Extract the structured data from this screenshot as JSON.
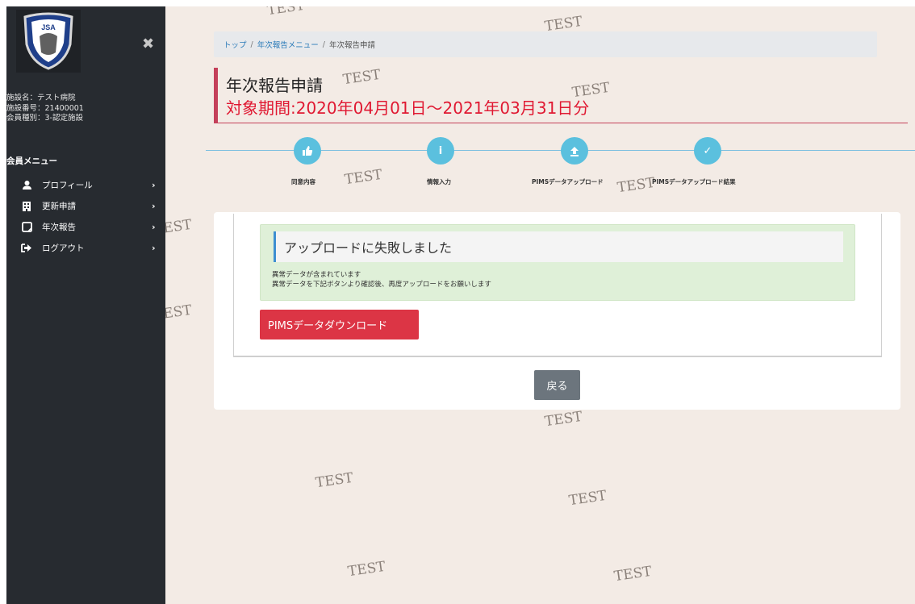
{
  "sidebar": {
    "logo_text": "JSA",
    "close_icon": "close-icon",
    "facility": {
      "name": "施設名：テスト病院",
      "number": "施設番号：21400001",
      "type": "会員種別：3-認定施設"
    },
    "menu_title": "会員メニュー",
    "items": [
      {
        "label": "プロフィール",
        "icon": "user-icon",
        "arrow": "›"
      },
      {
        "label": "更新申請",
        "icon": "building-icon",
        "arrow": "›"
      },
      {
        "label": "年次報告",
        "icon": "edit-icon",
        "arrow": "›"
      },
      {
        "label": "ログアウト",
        "icon": "logout-icon",
        "arrow": "›"
      }
    ]
  },
  "breadcrumb": {
    "top": "トップ",
    "sep": "/",
    "menu": "年次報告メニュー",
    "current": "年次報告申請"
  },
  "page": {
    "title": "年次報告申請",
    "period": "対象期間:2020年04月01日～2021年03月31日分"
  },
  "steps": [
    {
      "label": "同意内容",
      "icon": "thumbs-up-icon",
      "glyph": "👍"
    },
    {
      "label": "情報入力",
      "icon": "info-icon",
      "glyph": "i"
    },
    {
      "label": "PIMSデータアップロード",
      "icon": "upload-icon",
      "glyph": "⬆"
    },
    {
      "label": "PIMSデータアップロード結果",
      "icon": "check-icon",
      "glyph": "✓"
    }
  ],
  "alert": {
    "title": "アップロードに失敗しました",
    "line1": "異常データが含まれています",
    "line2": "異常データを下記ボタンより確認後、再度アップロードをお願いします"
  },
  "buttons": {
    "download": "PIMSデータダウンロード",
    "back": "戻る"
  },
  "watermark": "TEST",
  "colors": {
    "sidebar_bg": "#272b30",
    "page_bg": "#f3ebe5",
    "title_accent": "#c4405a",
    "period_red": "#e01932",
    "step_blue": "#5bc0de",
    "alert_green": "#dff0d8",
    "danger_button": "#dc3545",
    "back_button": "#6c757d"
  }
}
